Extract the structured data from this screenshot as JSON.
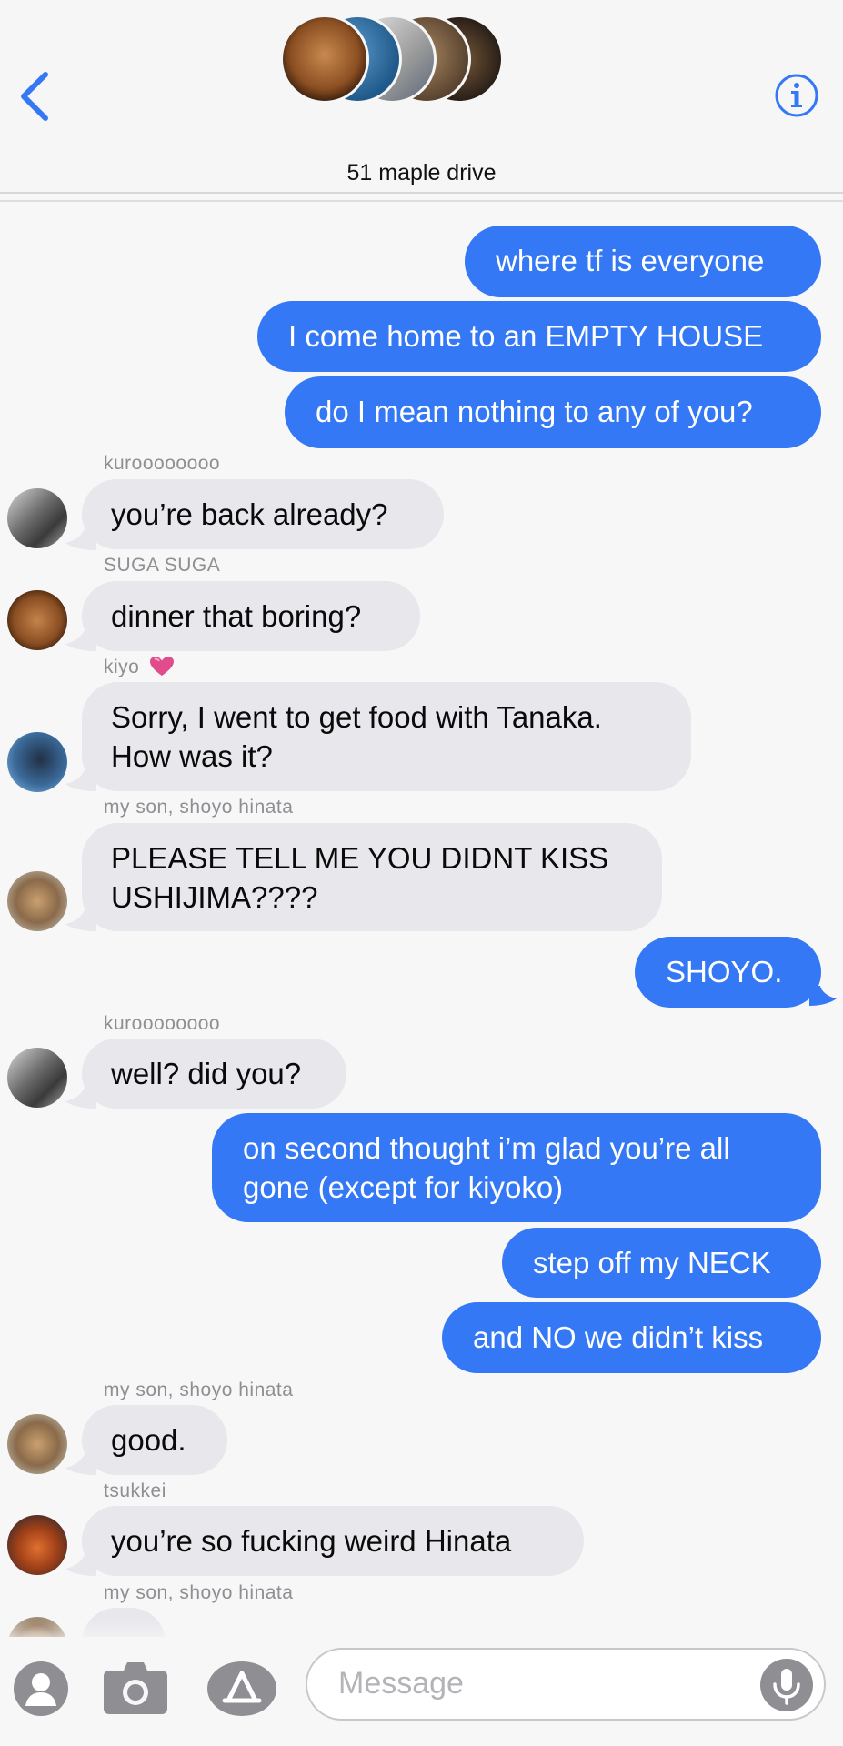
{
  "header": {
    "title": "51 maple drive"
  },
  "messages": [
    {
      "dir": "out",
      "text": "where tf is everyone"
    },
    {
      "dir": "out",
      "text": "I come home to an EMPTY HOUSE"
    },
    {
      "dir": "out",
      "text": "do I mean nothing to any of you?"
    },
    {
      "dir": "in",
      "sender": "kuroooooooo",
      "text": "you’re back already?"
    },
    {
      "dir": "in",
      "sender": "SUGA SUGA",
      "text": "dinner that boring?"
    },
    {
      "dir": "in",
      "sender": "kiyo",
      "text": "Sorry, I went to get food with Tanaka.\nHow was it?"
    },
    {
      "dir": "in",
      "sender": "my son, shoyo hinata",
      "text": "PLEASE TELL ME YOU DIDNT KISS\nUSHIJIMA????"
    },
    {
      "dir": "out",
      "text": "SHOYO."
    },
    {
      "dir": "in",
      "sender": "kuroooooooo",
      "text": "well? did you?"
    },
    {
      "dir": "out",
      "text": "on second thought i’m glad you’re all\ngone (except for kiyoko)"
    },
    {
      "dir": "out",
      "text": "step off my NECK"
    },
    {
      "dir": "out",
      "text": "and NO we didn’t kiss"
    },
    {
      "dir": "in",
      "sender": "my son, shoyo hinata",
      "text": "good."
    },
    {
      "dir": "in",
      "sender": "tsukkei",
      "text": "you’re so fucking weird Hinata"
    },
    {
      "dir": "in",
      "sender": "my son, shoyo hinata",
      "text": ""
    }
  ],
  "composer": {
    "placeholder": "Message"
  },
  "icons": {
    "back": "chevron-left-icon",
    "info": "info-icon",
    "contact": "person-icon",
    "camera": "camera-icon",
    "apps": "app-store-icon",
    "mic": "microphone-icon",
    "heart": "heart-emoji-icon"
  },
  "colors": {
    "accent": "#3478f6",
    "incoming_bubble": "#e7e7ec",
    "secondary_text": "#8e8e93"
  }
}
